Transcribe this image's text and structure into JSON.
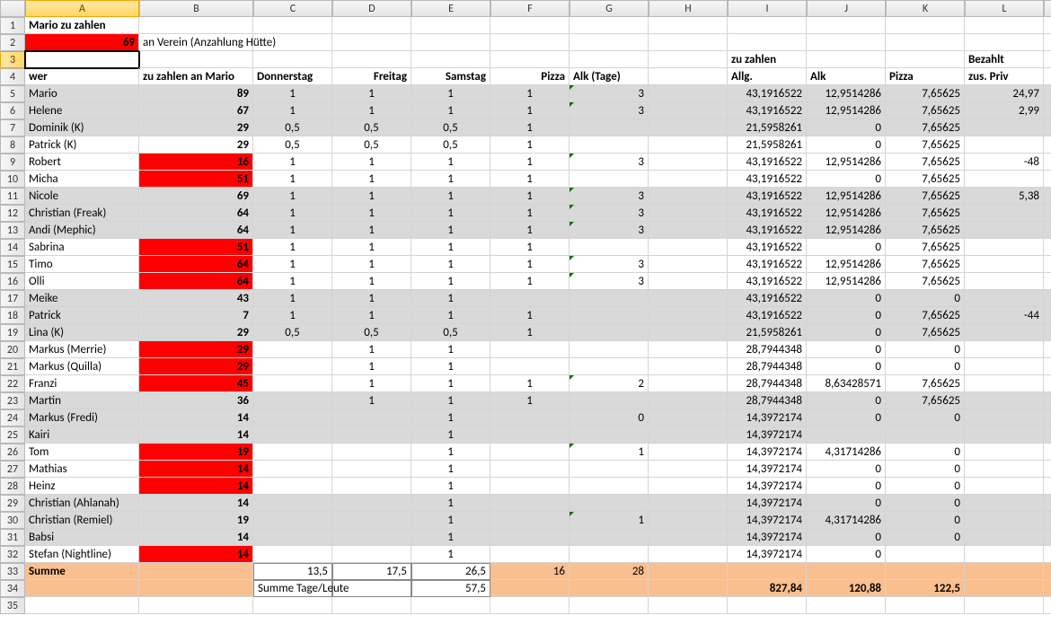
{
  "columns": [
    "A",
    "B",
    "C",
    "D",
    "E",
    "F",
    "G",
    "H",
    "I",
    "J",
    "K",
    "L",
    "M"
  ],
  "row_count": 35,
  "r1": {
    "a": "Mario zu zahlen"
  },
  "r2": {
    "a": "69",
    "b": "an Verein (Anzahlung Hütte)"
  },
  "r3": {
    "i": "zu zahlen",
    "l": "Bezahlt"
  },
  "r4": {
    "a": "wer",
    "b": "zu zahlen an Mario",
    "c": "Donnerstag",
    "d": "Freitag",
    "e": "Samstag",
    "f": "Pizza",
    "g": "Alk (Tage)",
    "i": "Allg.",
    "j": "Alk",
    "k": "Pizza",
    "l": "zus. Priv"
  },
  "rows": [
    {
      "a": "Mario",
      "b": "89",
      "c": "1",
      "d": "1",
      "e": "1",
      "f": "1",
      "g": "3",
      "i": "43,1916522",
      "j": "12,9514286",
      "k": "7,65625",
      "l": "24,97",
      "grey": true,
      "tri": false,
      "trig": true
    },
    {
      "a": "Helene",
      "b": "67",
      "c": "1",
      "d": "1",
      "e": "1",
      "f": "1",
      "g": "3",
      "i": "43,1916522",
      "j": "12,9514286",
      "k": "7,65625",
      "l": "2,99",
      "grey": true,
      "trig": true
    },
    {
      "a": "Dominik (K)",
      "b": "29",
      "c": "0,5",
      "d": "0,5",
      "e": "0,5",
      "f": "1",
      "g": "",
      "i": "21,5958261",
      "j": "0",
      "k": "7,65625",
      "l": "",
      "grey": true
    },
    {
      "a": "Patrick (K)",
      "b": "29",
      "c": "0,5",
      "d": "0,5",
      "e": "0,5",
      "f": "1",
      "g": "",
      "i": "21,5958261",
      "j": "0",
      "k": "7,65625",
      "l": ""
    },
    {
      "a": "Robert",
      "b": "16",
      "c": "1",
      "d": "1",
      "e": "1",
      "f": "1",
      "g": "3",
      "i": "43,1916522",
      "j": "12,9514286",
      "k": "7,65625",
      "l": "-48",
      "red": true,
      "trig": true
    },
    {
      "a": "Micha",
      "b": "51",
      "c": "1",
      "d": "1",
      "e": "1",
      "f": "1",
      "g": "",
      "i": "43,1916522",
      "j": "0",
      "k": "7,65625",
      "l": "",
      "red": true
    },
    {
      "a": "Nicole",
      "b": "69",
      "c": "1",
      "d": "1",
      "e": "1",
      "f": "1",
      "g": "3",
      "i": "43,1916522",
      "j": "12,9514286",
      "k": "7,65625",
      "l": "5,38",
      "red": true,
      "grey": true,
      "trig": true
    },
    {
      "a": "Christian (Freak)",
      "b": "64",
      "c": "1",
      "d": "1",
      "e": "1",
      "f": "1",
      "g": "3",
      "i": "43,1916522",
      "j": "12,9514286",
      "k": "7,65625",
      "l": "",
      "red": true,
      "grey": true,
      "trig": true
    },
    {
      "a": "Andi (Mephic)",
      "b": "64",
      "c": "1",
      "d": "1",
      "e": "1",
      "f": "1",
      "g": "3",
      "i": "43,1916522",
      "j": "12,9514286",
      "k": "7,65625",
      "l": "",
      "red": true,
      "grey": true,
      "trig": true
    },
    {
      "a": "Sabrina",
      "b": "51",
      "c": "1",
      "d": "1",
      "e": "1",
      "f": "1",
      "g": "",
      "i": "43,1916522",
      "j": "0",
      "k": "7,65625",
      "l": "",
      "red": true
    },
    {
      "a": "Timo",
      "b": "64",
      "c": "1",
      "d": "1",
      "e": "1",
      "f": "1",
      "g": "3",
      "i": "43,1916522",
      "j": "12,9514286",
      "k": "7,65625",
      "l": "",
      "red": true,
      "trig": true
    },
    {
      "a": "Olli",
      "b": "64",
      "c": "1",
      "d": "1",
      "e": "1",
      "f": "1",
      "g": "3",
      "i": "43,1916522",
      "j": "12,9514286",
      "k": "7,65625",
      "l": "",
      "red": true,
      "trig": true
    },
    {
      "a": "Meike",
      "b": "43",
      "c": "1",
      "d": "1",
      "e": "1",
      "f": "",
      "g": "",
      "i": "43,1916522",
      "j": "0",
      "k": "0",
      "l": "",
      "red": true,
      "grey": true
    },
    {
      "a": "Patrick",
      "b": "7",
      "c": "1",
      "d": "1",
      "e": "1",
      "f": "1",
      "g": "",
      "i": "43,1916522",
      "j": "0",
      "k": "7,65625",
      "l": "-44",
      "red": true,
      "grey": true
    },
    {
      "a": "Lina (K)",
      "b": "29",
      "c": "0,5",
      "d": "0,5",
      "e": "0,5",
      "f": "1",
      "g": "",
      "i": "21,5958261",
      "j": "0",
      "k": "7,65625",
      "l": "",
      "red": true,
      "grey": true
    },
    {
      "a": "Markus (Merrie)",
      "b": "29",
      "c": "",
      "d": "1",
      "e": "1",
      "f": "",
      "g": "",
      "i": "28,7944348",
      "j": "0",
      "k": "0",
      "l": "",
      "red": true
    },
    {
      "a": "Markus (Quilla)",
      "b": "29",
      "c": "",
      "d": "1",
      "e": "1",
      "f": "",
      "g": "",
      "i": "28,7944348",
      "j": "0",
      "k": "0",
      "l": "",
      "red": true
    },
    {
      "a": "Franzi",
      "b": "45",
      "c": "",
      "d": "1",
      "e": "1",
      "f": "1",
      "g": "2",
      "i": "28,7944348",
      "j": "8,63428571",
      "k": "7,65625",
      "l": "",
      "red": true,
      "trig": true
    },
    {
      "a": "Martin",
      "b": "36",
      "c": "",
      "d": "1",
      "e": "1",
      "f": "1",
      "g": "",
      "i": "28,7944348",
      "j": "0",
      "k": "7,65625",
      "l": "",
      "red": true,
      "grey": true
    },
    {
      "a": "Markus (Fredi)",
      "b": "14",
      "c": "",
      "d": "",
      "e": "1",
      "f": "",
      "g": "0",
      "i": "14,3972174",
      "j": "0",
      "k": "0",
      "l": "",
      "red": true,
      "grey": true
    },
    {
      "a": "Kairi",
      "b": "14",
      "c": "",
      "d": "",
      "e": "1",
      "f": "",
      "g": "",
      "i": "14,3972174",
      "j": "",
      "k": "",
      "l": "",
      "red": true,
      "grey": true
    },
    {
      "a": "Tom",
      "b": "19",
      "c": "",
      "d": "",
      "e": "1",
      "f": "",
      "g": "1",
      "i": "14,3972174",
      "j": "4,31714286",
      "k": "0",
      "l": "",
      "red": true,
      "trig": true
    },
    {
      "a": "Mathias",
      "b": "14",
      "c": "",
      "d": "",
      "e": "1",
      "f": "",
      "g": "",
      "i": "14,3972174",
      "j": "0",
      "k": "0",
      "l": "",
      "red": true
    },
    {
      "a": "Heinz",
      "b": "14",
      "c": "",
      "d": "",
      "e": "1",
      "f": "",
      "g": "",
      "i": "14,3972174",
      "j": "0",
      "k": "0",
      "l": "",
      "red": true
    },
    {
      "a": "Christian (Ahlanah)",
      "b": "14",
      "c": "",
      "d": "",
      "e": "1",
      "f": "",
      "g": "",
      "i": "14,3972174",
      "j": "0",
      "k": "0",
      "l": "",
      "red": true,
      "grey": true
    },
    {
      "a": "Christian (Remiel)",
      "b": "19",
      "c": "",
      "d": "",
      "e": "1",
      "f": "",
      "g": "1",
      "i": "14,3972174",
      "j": "4,31714286",
      "k": "0",
      "l": "",
      "red": true,
      "grey": true,
      "trig": true
    },
    {
      "a": "Babsi",
      "b": "14",
      "c": "",
      "d": "",
      "e": "1",
      "f": "",
      "g": "",
      "i": "14,3972174",
      "j": "0",
      "k": "0",
      "l": "",
      "red": true,
      "grey": true
    },
    {
      "a": "Stefan (Nightline)",
      "b": "14",
      "c": "",
      "d": "",
      "e": "1",
      "f": "",
      "g": "",
      "i": "14,3972174",
      "j": "0",
      "k": "",
      "l": "",
      "red": true
    }
  ],
  "r33": {
    "a": "Summe",
    "c": "13,5",
    "d": "17,5",
    "e": "26,5",
    "f": "16",
    "g": "28"
  },
  "r34": {
    "c": "Summe Tage/Leute",
    "e": "57,5",
    "i": "827,84",
    "j": "120,88",
    "k": "122,5"
  },
  "chart_data": {
    "type": "table",
    "title": "Mario zu zahlen",
    "note": "Spreadsheet tabulating payments per person"
  }
}
